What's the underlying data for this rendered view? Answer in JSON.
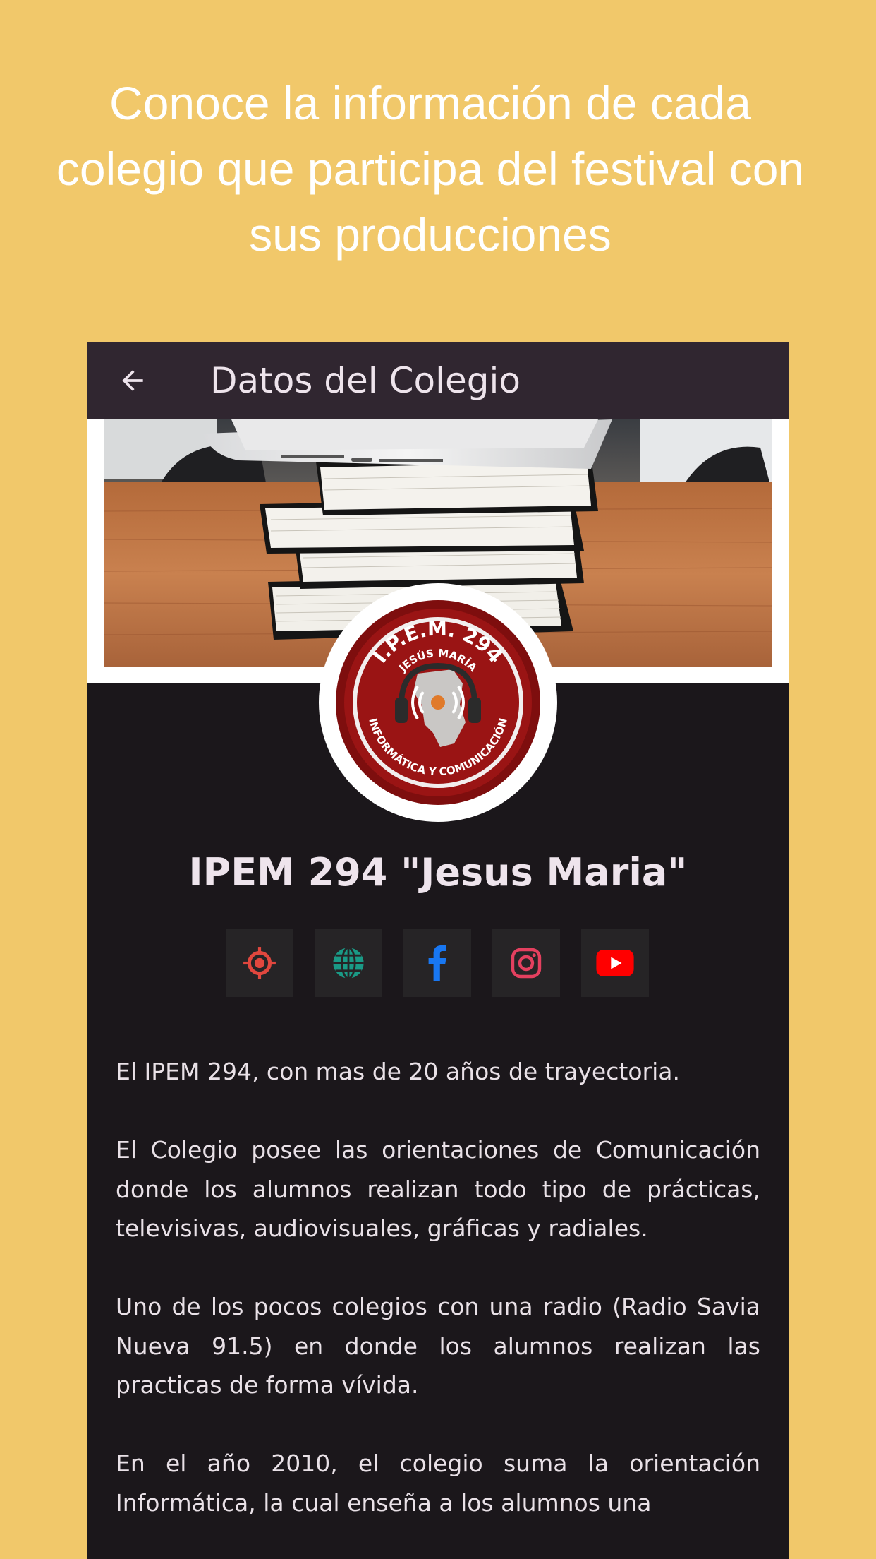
{
  "promo": {
    "heading": "Conoce la información de cada colegio que participa del festival con sus producciones"
  },
  "appbar": {
    "title": "Datos del Colegio",
    "back_icon": "arrow-left-icon"
  },
  "school": {
    "name": "IPEM 294 \"Jesus Maria\"",
    "logo": {
      "top_text": "I.P.E.M. 294",
      "sub_text": "JESÚS MARÍA",
      "bottom_text": "INFORMÁTICA Y COMUNICACIÓN"
    },
    "banner_image": "books-and-tablet-photo"
  },
  "social": [
    {
      "name": "location",
      "icon": "location-target-icon",
      "color": "#e1473e"
    },
    {
      "name": "website",
      "icon": "globe-icon",
      "color": "#1a9a86"
    },
    {
      "name": "facebook",
      "icon": "facebook-icon",
      "color": "#1877f2"
    },
    {
      "name": "instagram",
      "icon": "instagram-icon",
      "color": "#e4405f"
    },
    {
      "name": "youtube",
      "icon": "youtube-icon",
      "color": "#ff0000"
    }
  ],
  "description": [
    "El IPEM 294, con mas de 20 años de trayectoria.",
    "El Colegio posee las orientaciones de Comunicación donde los alumnos realizan todo tipo de prácticas, televisivas, audiovisuales, gráficas y radiales.",
    "Uno de los pocos colegios con una radio (Radio Savia Nueva 91.5) en donde los alumnos realizan las practicas de forma vívida.",
    "En el año 2010, el colegio suma la orientación Informática, la cual enseña a los alumnos una"
  ],
  "colors": {
    "page_background": "#f1c86a",
    "appbar": "#302630",
    "screen_background": "#1b171b",
    "text": "#eee4ec"
  }
}
